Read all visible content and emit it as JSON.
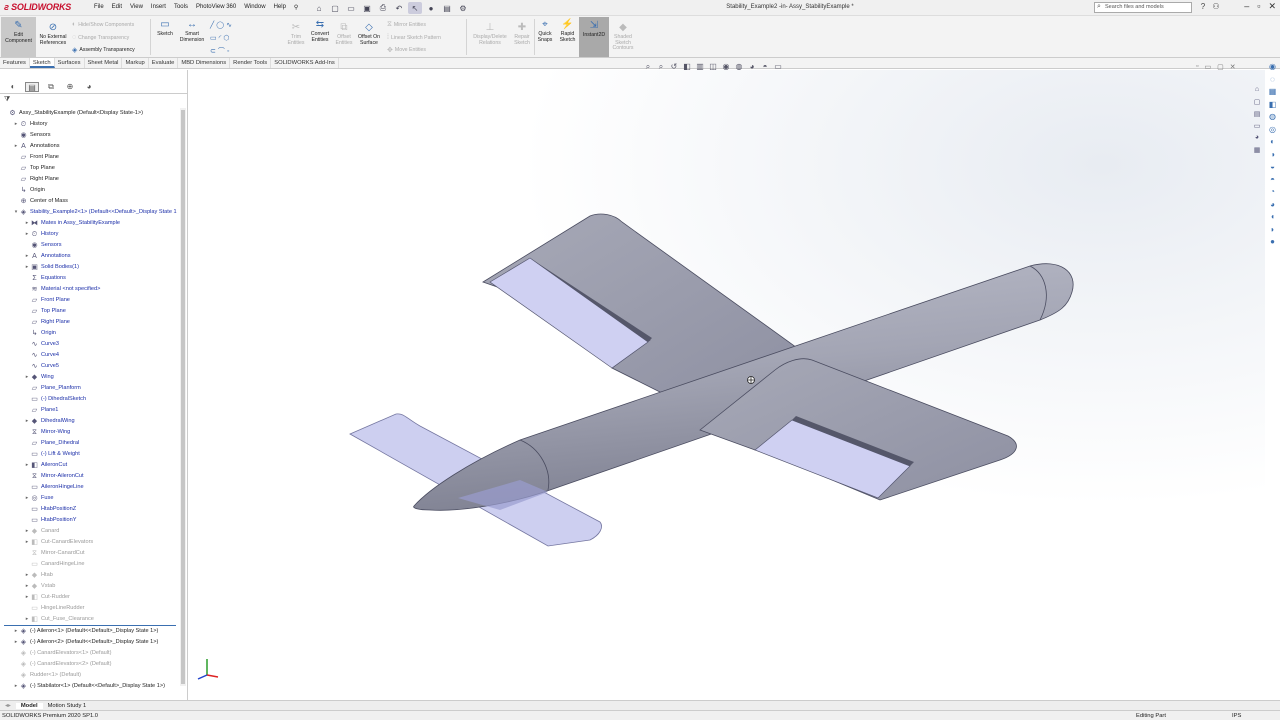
{
  "app": {
    "brand": "SOLIDWORKS",
    "document_title": "Stability_Example2 -in- Assy_StabilityExample *"
  },
  "menu": [
    "File",
    "Edit",
    "View",
    "Insert",
    "Tools",
    "PhotoView 360",
    "Window",
    "Help"
  ],
  "search": {
    "placeholder": "Search files and models"
  },
  "ribbon": {
    "edit_component": "Edit Component",
    "no_external_references": "No External References",
    "hide_show_components": "Hide/Show Components",
    "change_transparency": "Change Transparency",
    "assembly_transparency": "Assembly Transparency",
    "sketch": "Sketch",
    "smart_dimension": "Smart Dimension",
    "trim_entities": "Trim Entities",
    "convert_entities": "Convert Entities",
    "offset_entities": "Offset Entities",
    "offset_on_surface": "Offset On Surface",
    "mirror_entities": "Mirror Entities",
    "linear_sketch_pattern": "Linear Sketch Pattern",
    "move_entities": "Move Entities",
    "display_delete_relations": "Display/Delete Relations",
    "repair_sketch": "Repair Sketch",
    "quick_snaps": "Quick Snaps",
    "rapid_sketch": "Rapid Sketch",
    "instant2d": "Instant2D",
    "shaded_sketch_contours": "Shaded Sketch Contours"
  },
  "tabs": [
    {
      "label": "Features",
      "active": false
    },
    {
      "label": "Sketch",
      "active": true
    },
    {
      "label": "Surfaces",
      "active": false
    },
    {
      "label": "Sheet Metal",
      "active": false
    },
    {
      "label": "Markup",
      "active": false
    },
    {
      "label": "Evaluate",
      "active": false
    },
    {
      "label": "MBD Dimensions",
      "active": false
    },
    {
      "label": "Render Tools",
      "active": false
    },
    {
      "label": "SOLIDWORKS Add-Ins",
      "active": false
    }
  ],
  "tree": [
    {
      "label": "Assy_StabilityExample  (Default<Display State-1>)",
      "indent": 0,
      "icon": "assembly-icon",
      "expander": "",
      "style": ""
    },
    {
      "label": "History",
      "indent": 1,
      "icon": "history-icon",
      "expander": "▸",
      "style": ""
    },
    {
      "label": "Sensors",
      "indent": 1,
      "icon": "sensor-icon",
      "expander": "",
      "style": ""
    },
    {
      "label": "Annotations",
      "indent": 1,
      "icon": "annotation-icon",
      "expander": "▸",
      "style": ""
    },
    {
      "label": "Front Plane",
      "indent": 1,
      "icon": "plane-icon",
      "expander": "",
      "style": ""
    },
    {
      "label": "Top Plane",
      "indent": 1,
      "icon": "plane-icon",
      "expander": "",
      "style": ""
    },
    {
      "label": "Right Plane",
      "indent": 1,
      "icon": "plane-icon",
      "expander": "",
      "style": ""
    },
    {
      "label": "Origin",
      "indent": 1,
      "icon": "origin-icon",
      "expander": "",
      "style": ""
    },
    {
      "label": "Center of Mass",
      "indent": 1,
      "icon": "center-of-mass-icon",
      "expander": "",
      "style": ""
    },
    {
      "label": "Stability_Example2<1> (Default<<Default>_Display State 1",
      "indent": 1,
      "icon": "part-icon",
      "expander": "▾",
      "style": "blue"
    },
    {
      "label": "Mates in Assy_StabilityExample",
      "indent": 2,
      "icon": "mates-icon",
      "expander": "▸",
      "style": "blue"
    },
    {
      "label": "History",
      "indent": 2,
      "icon": "history-icon",
      "expander": "▸",
      "style": "blue"
    },
    {
      "label": "Sensors",
      "indent": 2,
      "icon": "sensor-icon",
      "expander": "",
      "style": "blue"
    },
    {
      "label": "Annotations",
      "indent": 2,
      "icon": "annotation-icon",
      "expander": "▸",
      "style": "blue"
    },
    {
      "label": "Solid Bodies(1)",
      "indent": 2,
      "icon": "solid-bodies-icon",
      "expander": "▸",
      "style": "blue"
    },
    {
      "label": "Equations",
      "indent": 2,
      "icon": "equations-icon",
      "expander": "",
      "style": "blue"
    },
    {
      "label": "Material <not specified>",
      "indent": 2,
      "icon": "material-icon",
      "expander": "",
      "style": "blue"
    },
    {
      "label": "Front Plane",
      "indent": 2,
      "icon": "plane-icon",
      "expander": "",
      "style": "blue"
    },
    {
      "label": "Top Plane",
      "indent": 2,
      "icon": "plane-icon",
      "expander": "",
      "style": "blue"
    },
    {
      "label": "Right Plane",
      "indent": 2,
      "icon": "plane-icon",
      "expander": "",
      "style": "blue"
    },
    {
      "label": "Origin",
      "indent": 2,
      "icon": "origin-icon",
      "expander": "",
      "style": "blue"
    },
    {
      "label": "Curve3",
      "indent": 2,
      "icon": "curve-icon",
      "expander": "",
      "style": "blue"
    },
    {
      "label": "Curve4",
      "indent": 2,
      "icon": "curve-icon",
      "expander": "",
      "style": "blue"
    },
    {
      "label": "Curve5",
      "indent": 2,
      "icon": "curve-icon",
      "expander": "",
      "style": "blue"
    },
    {
      "label": "Wing",
      "indent": 2,
      "icon": "feature-icon",
      "expander": "▸",
      "style": "blue"
    },
    {
      "label": "Plane_Planform",
      "indent": 2,
      "icon": "plane-icon",
      "expander": "",
      "style": "blue"
    },
    {
      "label": "(-) DihedralSketch",
      "indent": 2,
      "icon": "sketch-icon",
      "expander": "",
      "style": "blue"
    },
    {
      "label": "Plane1",
      "indent": 2,
      "icon": "plane-icon",
      "expander": "",
      "style": "blue"
    },
    {
      "label": "DihedralWing",
      "indent": 2,
      "icon": "feature-icon",
      "expander": "▸",
      "style": "blue"
    },
    {
      "label": "Mirror-Wing",
      "indent": 2,
      "icon": "mirror-icon",
      "expander": "",
      "style": "blue"
    },
    {
      "label": "Plane_Dihedral",
      "indent": 2,
      "icon": "plane-icon",
      "expander": "",
      "style": "blue"
    },
    {
      "label": "(-) Lift & Weight",
      "indent": 2,
      "icon": "sketch-icon",
      "expander": "",
      "style": "blue"
    },
    {
      "label": "AileronCut",
      "indent": 2,
      "icon": "cut-icon",
      "expander": "▸",
      "style": "blue"
    },
    {
      "label": "Mirror-AileronCut",
      "indent": 2,
      "icon": "mirror-icon",
      "expander": "",
      "style": "blue"
    },
    {
      "label": "AileronHingeLine",
      "indent": 2,
      "icon": "sketch-icon",
      "expander": "",
      "style": "blue"
    },
    {
      "label": "Fuse",
      "indent": 2,
      "icon": "revolve-icon",
      "expander": "▸",
      "style": "blue"
    },
    {
      "label": "HtabPositionZ",
      "indent": 2,
      "icon": "sketch-icon",
      "expander": "",
      "style": "blue"
    },
    {
      "label": "HtabPositionY",
      "indent": 2,
      "icon": "sketch-icon",
      "expander": "",
      "style": "blue"
    },
    {
      "label": "Canard",
      "indent": 2,
      "icon": "feature-icon",
      "expander": "▸",
      "style": "grey"
    },
    {
      "label": "Cut-CanardElevators",
      "indent": 2,
      "icon": "cut-icon",
      "expander": "▸",
      "style": "grey"
    },
    {
      "label": "Mirror-CanardCut",
      "indent": 2,
      "icon": "mirror-icon",
      "expander": "",
      "style": "grey"
    },
    {
      "label": "CanardHingeLine",
      "indent": 2,
      "icon": "sketch-icon",
      "expander": "",
      "style": "grey"
    },
    {
      "label": "Htab",
      "indent": 2,
      "icon": "feature-icon",
      "expander": "▸",
      "style": "grey"
    },
    {
      "label": "Vstab",
      "indent": 2,
      "icon": "feature-icon",
      "expander": "▸",
      "style": "grey"
    },
    {
      "label": "Cut-Rudder",
      "indent": 2,
      "icon": "cut-icon",
      "expander": "▸",
      "style": "grey"
    },
    {
      "label": "HingeLineRudder",
      "indent": 2,
      "icon": "sketch-icon",
      "expander": "",
      "style": "grey"
    },
    {
      "label": "Cut_Fuse_Clearance",
      "indent": 2,
      "icon": "cut-icon",
      "expander": "▸",
      "style": "grey"
    },
    {
      "label": "(-) Aileron<1> (Default<<Default>_Display State 1>)",
      "indent": 1,
      "icon": "part-icon",
      "expander": "▸",
      "style": ""
    },
    {
      "label": "(-) Aileron<2> (Default<<Default>_Display State 1>)",
      "indent": 1,
      "icon": "part-icon",
      "expander": "▸",
      "style": ""
    },
    {
      "label": "(-) CanardElevators<1> (Default)",
      "indent": 1,
      "icon": "part-icon",
      "expander": "",
      "style": "grey"
    },
    {
      "label": "(-) CanardElevators<2> (Default)",
      "indent": 1,
      "icon": "part-icon",
      "expander": "",
      "style": "grey"
    },
    {
      "label": "Rudder<1> (Default)",
      "indent": 1,
      "icon": "part-icon",
      "expander": "",
      "style": "grey"
    },
    {
      "label": "(-) Stabilator<1> (Default<<Default>_Display State 1>)",
      "indent": 1,
      "icon": "part-icon",
      "expander": "▸",
      "style": ""
    }
  ],
  "bottom_tabs": [
    {
      "label": "Model",
      "active": true
    },
    {
      "label": "Motion Study 1",
      "active": false
    }
  ],
  "status": {
    "version": "SOLIDWORKS Premium 2020 SP1.0",
    "mode": "Editing Part",
    "units": "IPS"
  },
  "colors": {
    "body_gray": "#a9abb8",
    "control_surface": "#cfd0f2",
    "accent": "#3a6fb0"
  }
}
